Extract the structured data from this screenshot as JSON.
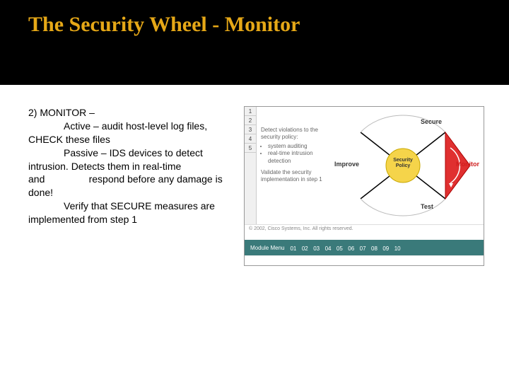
{
  "header": {
    "title": "The Security Wheel - Monitor"
  },
  "body": {
    "heading": "2) MONITOR –",
    "line1a": "Active – audit host-level log files, CHECK these files",
    "line2a": "Passive – IDS devices to detect intrusion.  Detects them in real-time and",
    "line2b": "respond before any damage is done!",
    "line3a": "Verify that SECURE measures are implemented from step 1"
  },
  "diagram": {
    "tabs": [
      "1",
      "2",
      "3",
      "4",
      "5"
    ],
    "info_heading": "Detect violations to the security policy:",
    "info_bullets": [
      "system auditing",
      "real-time intrusion detection"
    ],
    "info_sub": "Validate the security implementation in step 1",
    "labels": {
      "top": "Secure",
      "right": "Monitor",
      "bottom": "Test",
      "left": "Improve",
      "center": "Security Policy"
    },
    "menu_label": "Module Menu",
    "menu_items": [
      "01",
      "02",
      "03",
      "04",
      "05",
      "06",
      "07",
      "08",
      "09",
      "10"
    ],
    "copyright": "© 2002, Cisco Systems, Inc. All rights reserved."
  }
}
